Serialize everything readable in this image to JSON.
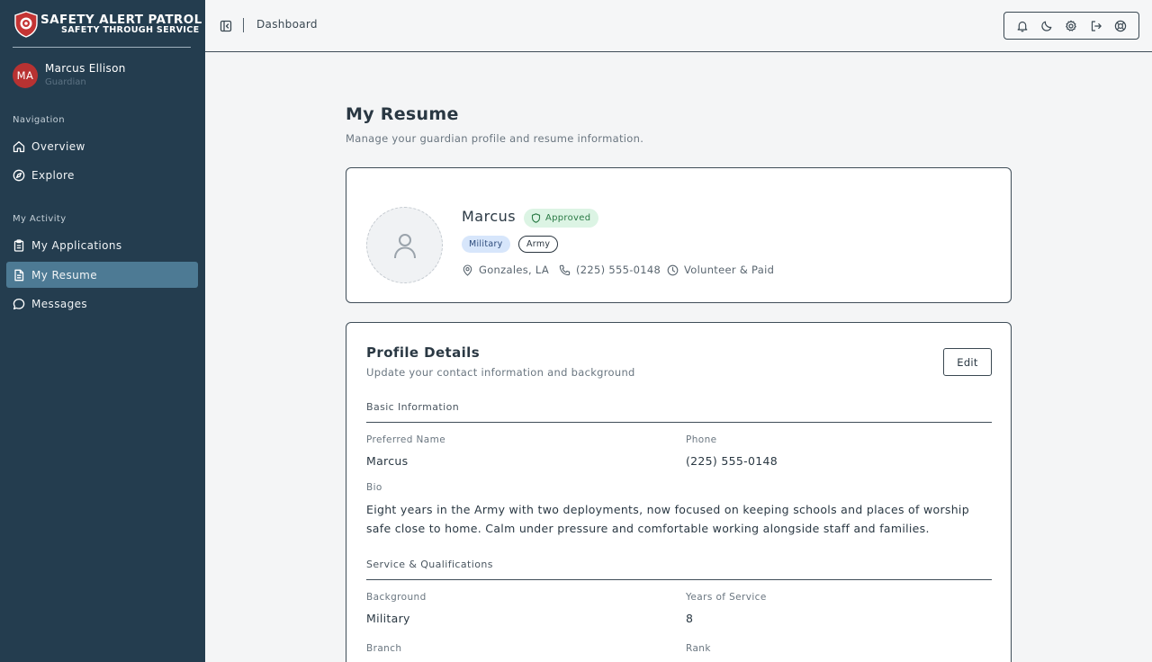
{
  "brand": {
    "title": "SAFETY ALERT PATROL",
    "subtitle": "SAFETY THROUGH SERVICE"
  },
  "user": {
    "initials": "MA",
    "name": "Marcus Ellison",
    "role": "Guardian"
  },
  "sidebar": {
    "navigation_label": "Navigation",
    "navigation": [
      {
        "label": "Overview",
        "icon": "home-icon"
      },
      {
        "label": "Explore",
        "icon": "compass-icon"
      }
    ],
    "activity_label": "My Activity",
    "activity": [
      {
        "label": "My Applications",
        "icon": "clipboard-icon"
      },
      {
        "label": "My Resume",
        "icon": "document-icon",
        "active": true
      },
      {
        "label": "Messages",
        "icon": "chat-icon"
      }
    ]
  },
  "header": {
    "breadcrumb": "Dashboard",
    "actions": [
      "bell-icon",
      "moon-icon",
      "gear-icon",
      "logout-icon",
      "help-icon"
    ]
  },
  "page": {
    "title": "My Resume",
    "subtitle": "Manage your guardian profile and resume information."
  },
  "profile": {
    "name": "Marcus",
    "status": "Approved",
    "tags": [
      "Military",
      "Army"
    ],
    "location": "Gonzales, LA",
    "phone": "(225) 555-0148",
    "availability": "Volunteer & Paid"
  },
  "details": {
    "title": "Profile Details",
    "subtitle": "Update your contact information and background",
    "edit_label": "Edit",
    "basic": {
      "heading": "Basic Information",
      "preferred_name_label": "Preferred Name",
      "preferred_name": "Marcus",
      "phone_label": "Phone",
      "phone": "(225) 555-0148",
      "bio_label": "Bio",
      "bio": "Eight years in the Army with two deployments, now focused on keeping schools and places of worship safe close to home. Calm under pressure and comfortable working alongside staff and families."
    },
    "service": {
      "heading": "Service & Qualifications",
      "background_label": "Background",
      "background": "Military",
      "years_label": "Years of Service",
      "years": "8",
      "branch_label": "Branch",
      "rank_label": "Rank"
    }
  },
  "colors": {
    "sidebar_bg": "#243d4f",
    "active_nav": "#4d7a94",
    "avatar": "#b83232",
    "approved_bg": "#dcf4e4",
    "military_tag_bg": "#d7e6fb"
  }
}
